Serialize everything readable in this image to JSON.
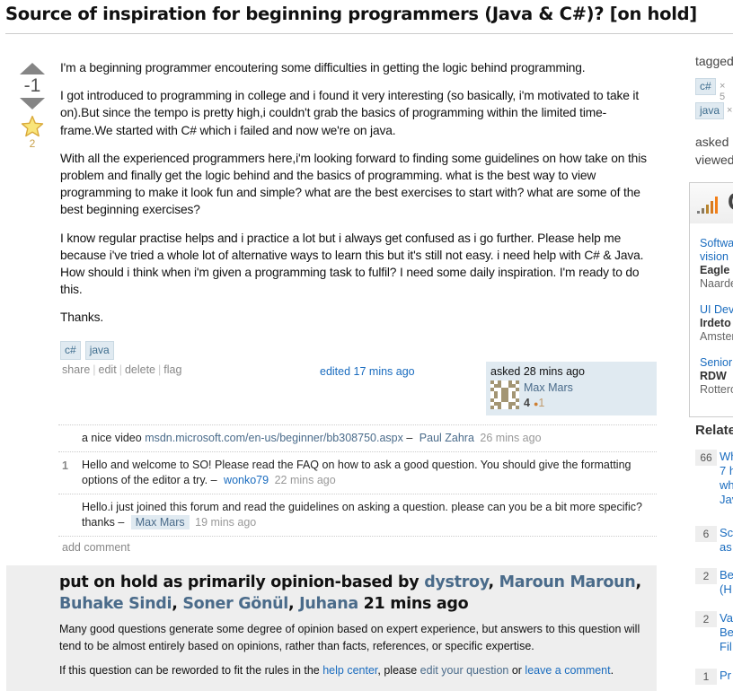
{
  "question": {
    "title": "Source of inspiration for beginning programmers (Java & C#)? [on hold]",
    "vote_count": "-1",
    "favorite_count": "2",
    "body": [
      "I'm a beginning programmer encoutering some difficulties in getting the logic behind programming.",
      "I got introduced to programming in college and i found it very interesting (so basically, i'm motivated to take it on).But since the tempo is pretty high,i couldn't grab the basics of programming within the limited time-frame.We started with C# which i failed and now we're on java.",
      "With all the experienced programmers here,i'm looking forward to finding some guidelines on how take on this problem and finally get the logic behind and the basics of programming. what is the best way to view programming to make it look fun and simple? what are the best exercises to start with? what are some of the best beginning exercises?",
      "I know regular practise helps and i practice a lot but i always get confused as i go further. Please help me because i've tried a whole lot of alternative ways to learn this but it's still not easy. i need help with C# & Java. How should i think when i'm given a programming task to fulfil? I need some daily inspiration. I'm ready to do this.",
      "Thanks."
    ],
    "tags": [
      "c#",
      "java"
    ],
    "menu": [
      "share",
      "edit",
      "delete",
      "flag"
    ],
    "edited": "edited 17 mins ago",
    "owner": {
      "asked": "asked 28 mins ago",
      "name": "Max Mars",
      "reputation": "4",
      "bronze_badges": "1",
      "badge_color": "#cd7f32"
    }
  },
  "comments": [
    {
      "score": "",
      "text": "a nice video ",
      "link": "msdn.microsoft.com/en-us/beginner/bb308750.aspx",
      "dash": " –",
      "user": "Paul Zahra",
      "time": "26 mins ago"
    },
    {
      "score": "1",
      "text": "Hello and welcome to SO! Please read the FAQ on how to ask a good question. You should give the formatting options of the editor a try.",
      "link": "",
      "dash": " –",
      "user": "wonko79",
      "time": "22 mins ago"
    },
    {
      "score": "",
      "text": "Hello.i just joined this forum and read the guidelines on asking a question. please can you be a bit more specific? thanks",
      "link": "",
      "dash": " –",
      "user": "Max Mars",
      "time": "19 mins ago"
    }
  ],
  "add_comment": "add comment",
  "hold": {
    "prefix": "put on hold as primarily opinion-based by ",
    "users": [
      "dystroy",
      "Maroun Maroun",
      "Buhake Sindi",
      "Soner Gönül",
      "Juhana"
    ],
    "time": "21 mins ago",
    "reason": "Many good questions generate some degree of opinion based on expert experience, but answers to this question will tend to be almost entirely based on opinions, rather than facts, references, or specific expertise.",
    "reword_prefix": "If this question can be reworded to fit the rules in the ",
    "help_center": "help center",
    "reword_mid": ", please ",
    "edit_link": "edit your question",
    "reword_or": " or ",
    "comment_link": "leave a comment",
    "reword_end": "."
  },
  "sidebar": {
    "tagged_label": "tagged",
    "tags": [
      {
        "name": "c#",
        "mult": "× 5"
      },
      {
        "name": "java",
        "mult": "×"
      }
    ],
    "asked_label": "asked",
    "viewed_label": "viewed",
    "jobs_logo_text": "C",
    "jobs": [
      {
        "title": "Softwa",
        "title2": "vision",
        "company": "Eagle V",
        "location": "Naarde"
      },
      {
        "title": "UI Dev",
        "company": "Irdeto",
        "location": "Amster"
      },
      {
        "title": "Senior",
        "company": "RDW",
        "location": "Rottero"
      }
    ],
    "related_heading": "Relate",
    "related": [
      {
        "count": "66",
        "lines": [
          "Wh",
          "7 h",
          "wh",
          "Jav"
        ]
      },
      {
        "count": "6",
        "lines": [
          "Sc",
          "as"
        ]
      },
      {
        "count": "2",
        "lines": [
          "Be",
          "(H"
        ]
      },
      {
        "count": "2",
        "lines": [
          "Va",
          "Be",
          "Fil"
        ]
      },
      {
        "count": "1",
        "lines": [
          "Pr"
        ]
      }
    ]
  }
}
